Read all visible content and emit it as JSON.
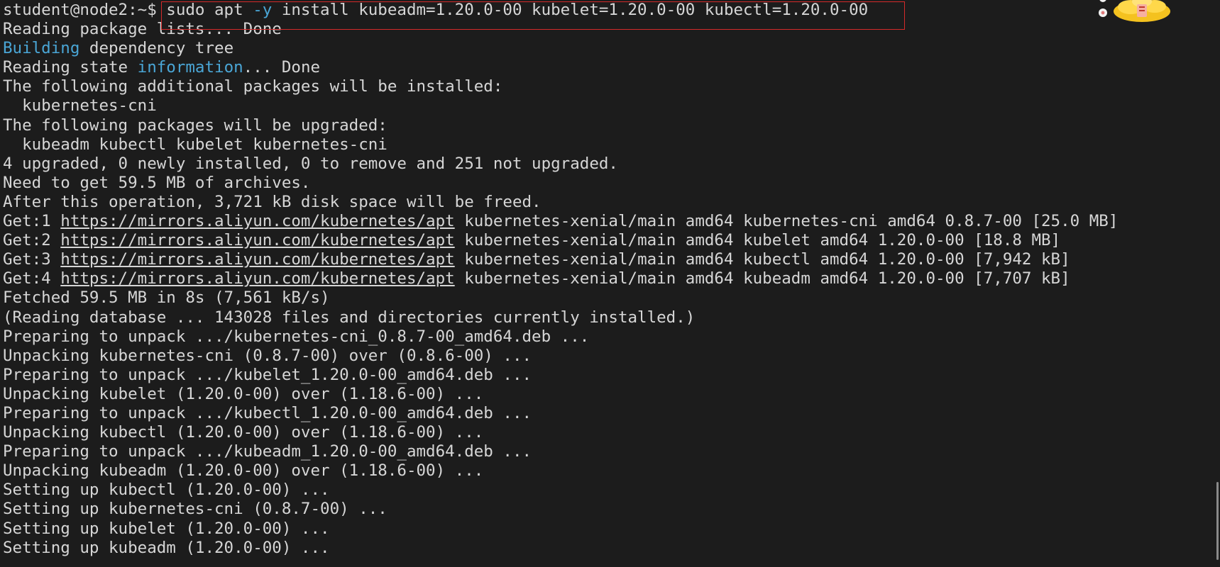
{
  "terminal": {
    "lines": [
      [
        {
          "t": "student@node2:~$ sudo apt ",
          "s": "plain"
        },
        {
          "t": "-y",
          "s": "cyan"
        },
        {
          "t": " install kubeadm=1.20.0-00 kubelet=1.20.0-00 kubectl=1.20.0-00",
          "s": "plain"
        }
      ],
      [
        {
          "t": "Reading package lists... Done",
          "s": "plain"
        }
      ],
      [
        {
          "t": "Building",
          "s": "cyan"
        },
        {
          "t": " dependency tree",
          "s": "plain"
        }
      ],
      [
        {
          "t": "Reading state ",
          "s": "plain"
        },
        {
          "t": "information",
          "s": "cyan"
        },
        {
          "t": "... Done",
          "s": "plain"
        }
      ],
      [
        {
          "t": "The following additional packages will be installed:",
          "s": "plain"
        }
      ],
      [
        {
          "t": "  kubernetes-cni",
          "s": "plain"
        }
      ],
      [
        {
          "t": "The following packages will be upgraded:",
          "s": "plain"
        }
      ],
      [
        {
          "t": "  kubeadm kubectl kubelet kubernetes-cni",
          "s": "plain"
        }
      ],
      [
        {
          "t": "4 upgraded, 0 newly installed, 0 to remove and 251 not upgraded.",
          "s": "plain"
        }
      ],
      [
        {
          "t": "Need to get 59.5 MB of archives.",
          "s": "plain"
        }
      ],
      [
        {
          "t": "After this operation, 3,721 kB disk space will be freed.",
          "s": "plain"
        }
      ],
      [
        {
          "t": "Get:1 ",
          "s": "plain"
        },
        {
          "t": "https://mirrors.aliyun.com/kubernetes/apt",
          "s": "link"
        },
        {
          "t": " kubernetes-xenial/main amd64 kubernetes-cni amd64 0.8.7-00 [25.0 MB]",
          "s": "plain"
        }
      ],
      [
        {
          "t": "Get:2 ",
          "s": "plain"
        },
        {
          "t": "https://mirrors.aliyun.com/kubernetes/apt",
          "s": "link"
        },
        {
          "t": " kubernetes-xenial/main amd64 kubelet amd64 1.20.0-00 [18.8 MB]",
          "s": "plain"
        }
      ],
      [
        {
          "t": "Get:3 ",
          "s": "plain"
        },
        {
          "t": "https://mirrors.aliyun.com/kubernetes/apt",
          "s": "link"
        },
        {
          "t": " kubernetes-xenial/main amd64 kubectl amd64 1.20.0-00 [7,942 kB]",
          "s": "plain"
        }
      ],
      [
        {
          "t": "Get:4 ",
          "s": "plain"
        },
        {
          "t": "https://mirrors.aliyun.com/kubernetes/apt",
          "s": "link"
        },
        {
          "t": " kubernetes-xenial/main amd64 kubeadm amd64 1.20.0-00 [7,707 kB]",
          "s": "plain"
        }
      ],
      [
        {
          "t": "Fetched 59.5 MB in 8s (7,561 kB/s)",
          "s": "plain"
        }
      ],
      [
        {
          "t": "(Reading database ... 143028 files and directories currently installed.)",
          "s": "plain"
        }
      ],
      [
        {
          "t": "Preparing to unpack .../kubernetes-cni_0.8.7-00_amd64.deb ...",
          "s": "plain"
        }
      ],
      [
        {
          "t": "Unpacking kubernetes-cni (0.8.7-00) over (0.8.6-00) ...",
          "s": "plain"
        }
      ],
      [
        {
          "t": "Preparing to unpack .../kubelet_1.20.0-00_amd64.deb ...",
          "s": "plain"
        }
      ],
      [
        {
          "t": "Unpacking kubelet (1.20.0-00) over (1.18.6-00) ...",
          "s": "plain"
        }
      ],
      [
        {
          "t": "Preparing to unpack .../kubectl_1.20.0-00_amd64.deb ...",
          "s": "plain"
        }
      ],
      [
        {
          "t": "Unpacking kubectl (1.20.0-00) over (1.18.6-00) ...",
          "s": "plain"
        }
      ],
      [
        {
          "t": "Preparing to unpack .../kubeadm_1.20.0-00_amd64.deb ...",
          "s": "plain"
        }
      ],
      [
        {
          "t": "Unpacking kubeadm (1.20.0-00) over (1.18.6-00) ...",
          "s": "plain"
        }
      ],
      [
        {
          "t": "Setting up kubectl (1.20.0-00) ...",
          "s": "plain"
        }
      ],
      [
        {
          "t": "Setting up kubernetes-cni (0.8.7-00) ...",
          "s": "plain"
        }
      ],
      [
        {
          "t": "Setting up kubelet (1.20.0-00) ...",
          "s": "plain"
        }
      ],
      [
        {
          "t": "Setting up kubeadm (1.20.0-00) ...",
          "s": "plain"
        }
      ]
    ]
  },
  "colors": {
    "background": "#1c1c1c",
    "text": "#d6d6d6",
    "cyan": "#4aa6d6",
    "highlight": "#d42a2a"
  },
  "decorations": {
    "mascot_icon": "gold-ingot-mascot-icon"
  }
}
